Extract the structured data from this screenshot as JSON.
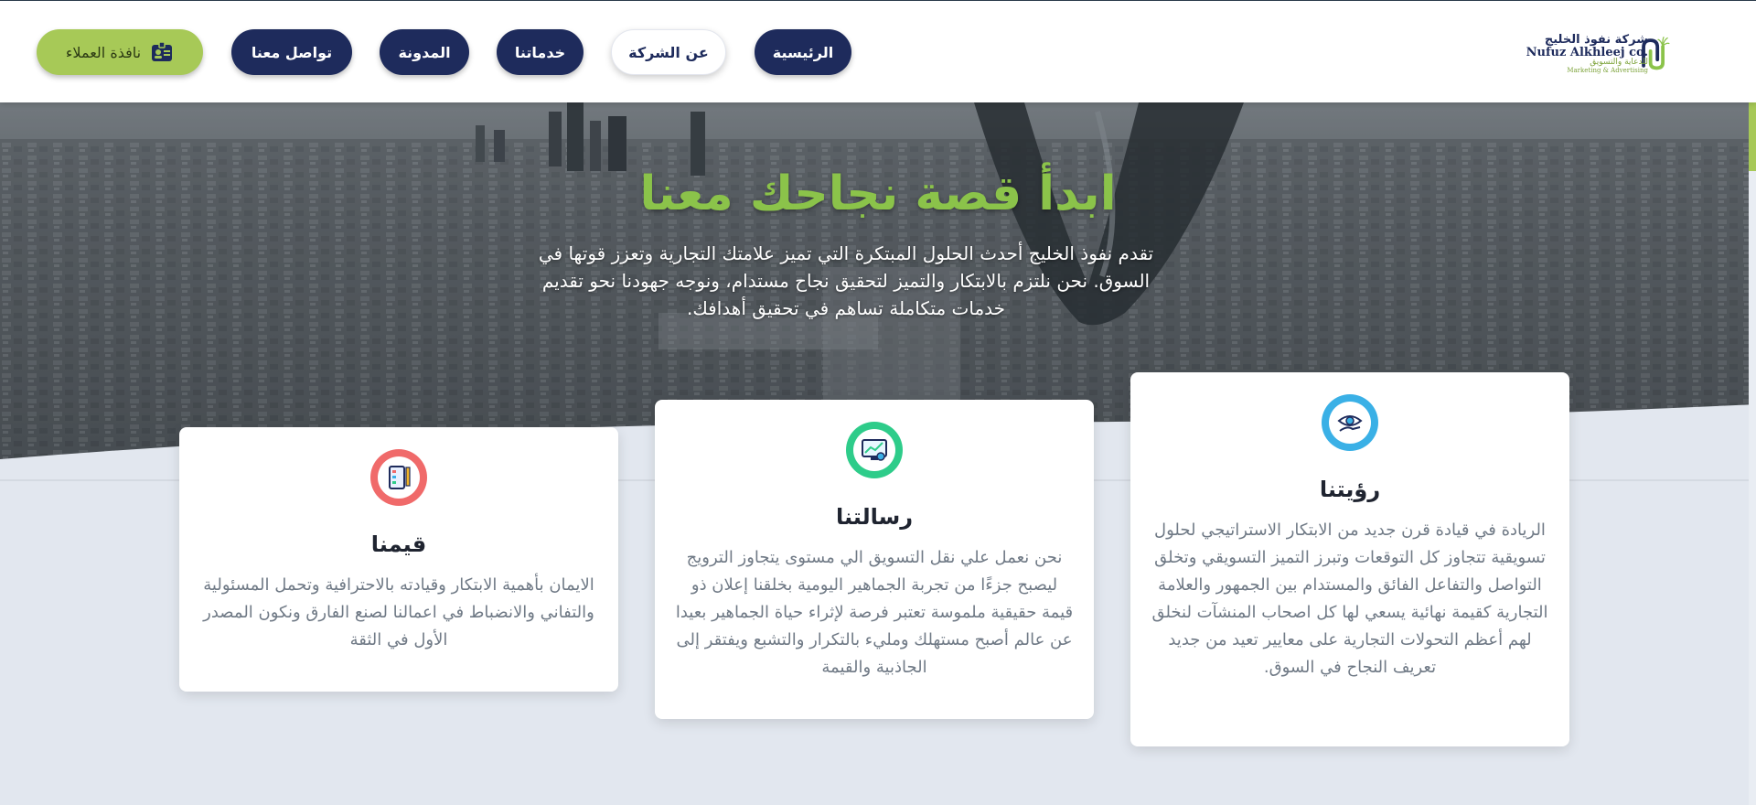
{
  "header": {
    "logo": {
      "name_ar": "شركة نفوذ الخليج",
      "name_en": "Nufuz Alkhleej co.",
      "tagline_ar": "للدعاية والتسويق",
      "tagline_en": "Marketing & Advertising"
    },
    "nav": [
      {
        "label": "الرئيسية",
        "active": false
      },
      {
        "label": "عن الشركة",
        "active": true
      },
      {
        "label": "خدماتنا",
        "active": false
      },
      {
        "label": "المدونة",
        "active": false
      },
      {
        "label": "تواصل معنا",
        "active": false
      }
    ],
    "client_button": {
      "label": "نافذة العملاء",
      "icon": "id-badge-icon"
    }
  },
  "hero": {
    "title": "ابدأ قصة نجاحك معنا",
    "text": "تقدم نفوذ الخليج أحدث الحلول المبتكرة التي تميز علامتك التجارية وتعزز قوتها في السوق. نحن نلتزم بالابتكار والتميز لتحقيق نجاح مستدام، ونوجه جهودنا نحو تقديم خدمات متكاملة تساهم في تحقيق أهدافك."
  },
  "cards": [
    {
      "title": "رؤيتنا",
      "icon": "vision-eye-hand-icon",
      "color": "#3ab0e6",
      "text": "الريادة في قيادة قرن جديد من الابتكار الاستراتيجي لحلول تسويقية تتجاوز كل التوقعات وتبرز التميز التسويقي وتخلق التواصل والتفاعل الفائق والمستدام بين الجمهور والعلامة التجارية كقيمة نهائية يسعي لها كل اصحاب المنشآت لنخلق لهم أعظم التحولات التجارية على معايير تعيد من جديد تعريف النجاح في السوق."
    },
    {
      "title": "رسالتنا",
      "icon": "mission-chart-icon",
      "color": "#2ecc8a",
      "text": "نحن نعمل علي نقل التسويق الي مستوى يتجاوز الترويج ليصبح جزءًا من تجربة الجماهير اليومية بخلقنا إعلان ذو قيمة حقيقية ملموسة تعتبر فرصة لإثراء حياة الجماهير بعيدا عن عالم أصبح مستهلك ومليء بالتكرار والتشبع ويفتقر إلى الجاذبية والقيمة"
    },
    {
      "title": "قيمنا",
      "icon": "values-tools-icon",
      "color": "#f06a6a",
      "text": "الايمان بأهمية الابتكار وقيادته بالاحترافية وتحمل المسئولية والتفاني والانضباط في اعمالنا لصنع الفارق ونكون المصدر الأول في الثقة"
    }
  ],
  "colors": {
    "navy": "#1e2b5c",
    "green": "#a7c957",
    "title_green": "#8bc34a"
  }
}
